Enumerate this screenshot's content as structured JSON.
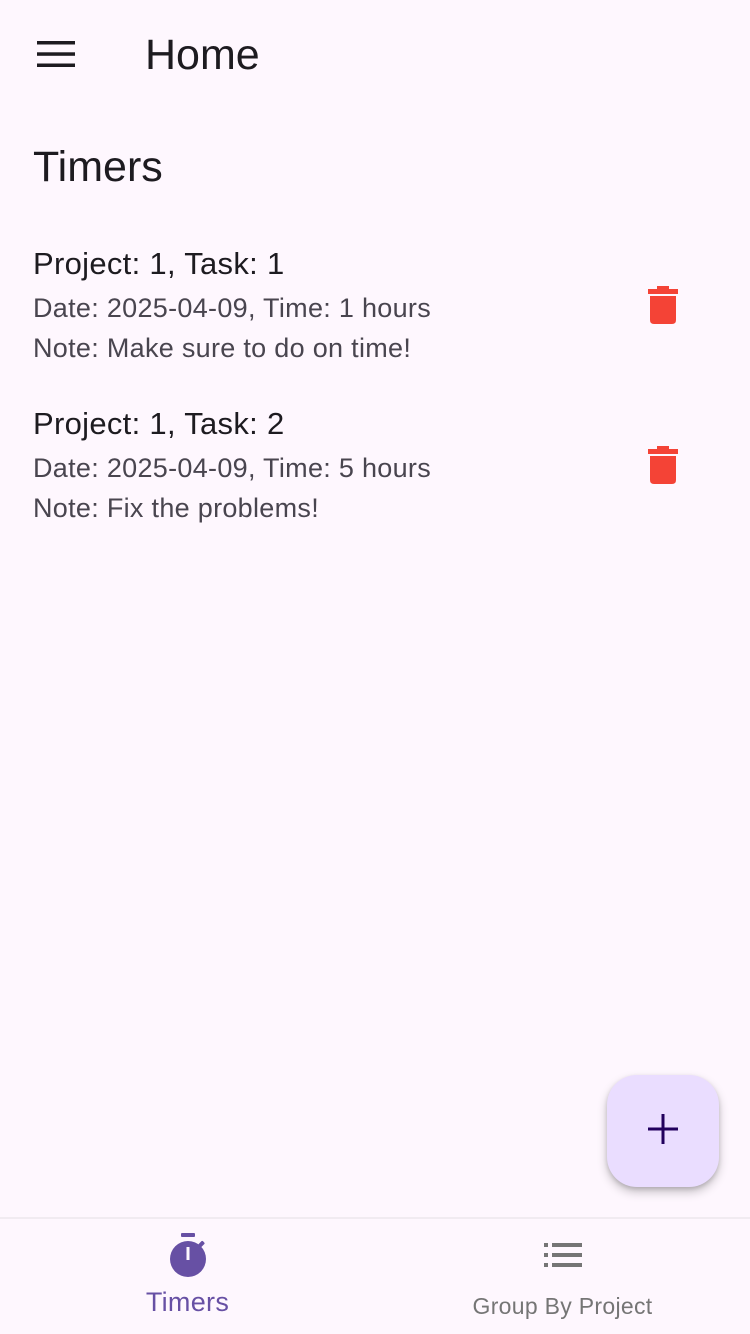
{
  "appbar": {
    "title": "Home",
    "menu_icon": "hamburger-menu-icon"
  },
  "section": {
    "title": "Timers"
  },
  "timers": [
    {
      "title": "Project: 1, Task: 1",
      "date_time": "Date: 2025-04-09, Time: 1 hours",
      "note": "Note: Make sure to do on time!",
      "delete_icon": "trash-icon"
    },
    {
      "title": "Project: 1, Task: 2",
      "date_time": "Date: 2025-04-09, Time: 5 hours",
      "note": "Note: Fix the problems!",
      "delete_icon": "trash-icon"
    }
  ],
  "fab": {
    "icon": "plus-icon"
  },
  "bottom_nav": {
    "items": [
      {
        "label": "Timers",
        "icon": "stopwatch-icon",
        "selected": true
      },
      {
        "label": "Group By Project",
        "icon": "list-icon",
        "selected": false
      }
    ]
  },
  "colors": {
    "background": "#fef7fe",
    "primary": "#6750a4",
    "delete": "#f44336",
    "fab_container": "#eaddff",
    "fab_icon": "#21005d",
    "on_surface": "#1d1b20",
    "on_surface_variant": "#49454f",
    "nav_unselected": "#757575"
  }
}
